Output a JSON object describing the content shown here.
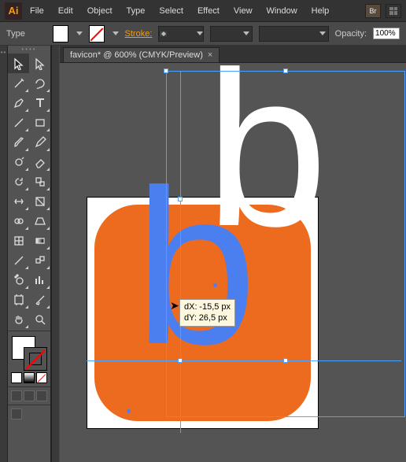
{
  "app": {
    "logo_text": "Ai"
  },
  "menu": {
    "items": [
      "File",
      "Edit",
      "Object",
      "Type",
      "Select",
      "Effect",
      "View",
      "Window",
      "Help"
    ],
    "bridge_badge": "Br"
  },
  "ctrl": {
    "context_label": "Type",
    "stroke_label": "Stroke:",
    "stroke_weight": "",
    "opacity_label": "Opacity:",
    "opacity_value": "100%"
  },
  "tab": {
    "title": "favicon* @ 600% (CMYK/Preview)",
    "close": "×"
  },
  "tools": [
    {
      "n": "selection-tool",
      "sel": true,
      "svg": "arrow"
    },
    {
      "n": "direct-selection-tool",
      "svg": "arrow-o"
    },
    {
      "n": "magic-wand-tool",
      "svg": "wand",
      "c": true
    },
    {
      "n": "lasso-tool",
      "svg": "lasso",
      "c": true
    },
    {
      "n": "pen-tool",
      "svg": "pen",
      "c": true
    },
    {
      "n": "type-tool",
      "svg": "type",
      "c": true
    },
    {
      "n": "line-tool",
      "svg": "line",
      "c": true
    },
    {
      "n": "rectangle-tool",
      "svg": "rect",
      "c": true
    },
    {
      "n": "brush-tool",
      "svg": "brush",
      "c": true
    },
    {
      "n": "pencil-tool",
      "svg": "pencil",
      "c": true
    },
    {
      "n": "blob-brush-tool",
      "svg": "blob",
      "c": true
    },
    {
      "n": "eraser-tool",
      "svg": "eraser",
      "c": true
    },
    {
      "n": "rotate-tool",
      "svg": "rotate",
      "c": true
    },
    {
      "n": "scale-tool",
      "svg": "scale",
      "c": true
    },
    {
      "n": "width-tool",
      "svg": "width",
      "c": true
    },
    {
      "n": "free-transform-tool",
      "svg": "ft",
      "c": true
    },
    {
      "n": "shape-builder-tool",
      "svg": "sb",
      "c": true
    },
    {
      "n": "perspective-tool",
      "svg": "persp",
      "c": true
    },
    {
      "n": "mesh-tool",
      "svg": "mesh"
    },
    {
      "n": "gradient-tool",
      "svg": "grad",
      "c": true
    },
    {
      "n": "eyedropper-tool",
      "svg": "eye",
      "c": true
    },
    {
      "n": "blend-tool",
      "svg": "blend",
      "c": true
    },
    {
      "n": "symbol-sprayer-tool",
      "svg": "spray",
      "c": true
    },
    {
      "n": "graph-tool",
      "svg": "graph",
      "c": true
    },
    {
      "n": "artboard-tool",
      "svg": "artb",
      "c": true
    },
    {
      "n": "slice-tool",
      "svg": "slice",
      "c": true
    },
    {
      "n": "hand-tool",
      "svg": "hand",
      "c": true
    },
    {
      "n": "zoom-tool",
      "svg": "zoom"
    }
  ],
  "tooltip": {
    "dx_label": "dX:",
    "dx_value": "-15,5 px",
    "dy_label": "dY:",
    "dy_value": "26,5 px"
  },
  "colors": {
    "accent_orange": "#ec6b1f",
    "accent_blue": "#4b7ff0",
    "selection_blue": "#4aa3ff",
    "app_orange": "#ff9a00",
    "fill": "#ffffff",
    "stroke": "none"
  },
  "letters": {
    "white": "b",
    "blue": "b"
  }
}
